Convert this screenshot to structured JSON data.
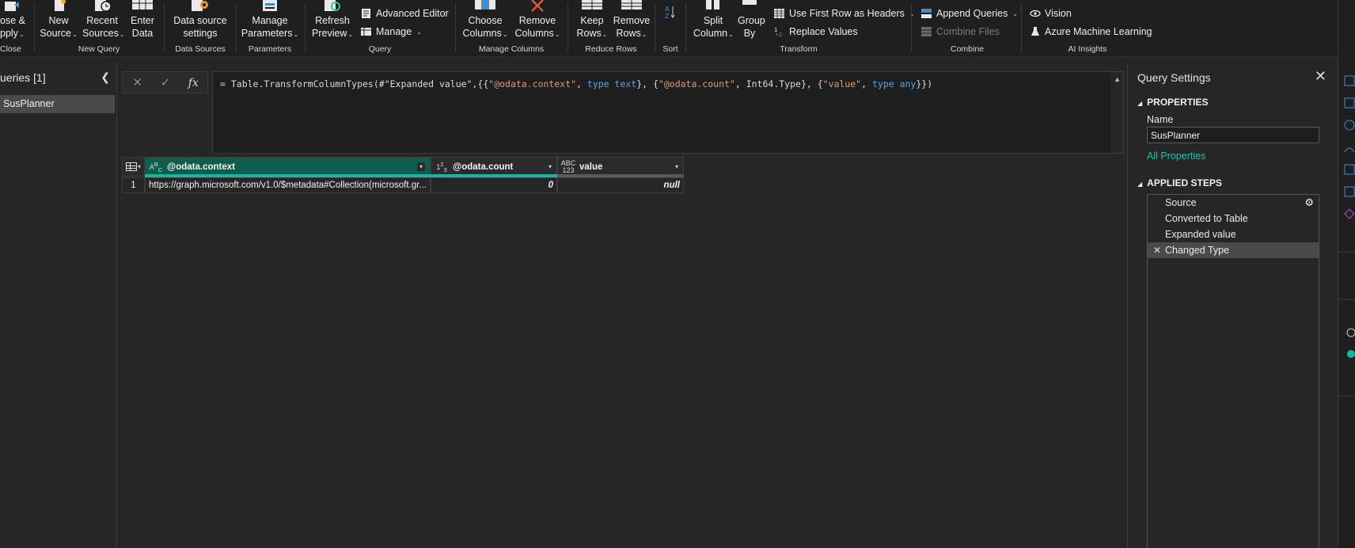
{
  "ribbon": {
    "groups": [
      {
        "label": "Close",
        "buttons": [
          {
            "line1": "ose &",
            "line2": "pply"
          }
        ]
      },
      {
        "label": "New Query",
        "buttons": [
          {
            "line1": "New",
            "line2": "Source"
          },
          {
            "line1": "Recent",
            "line2": "Sources"
          },
          {
            "line1": "Enter",
            "line2": "Data"
          }
        ]
      },
      {
        "label": "Data Sources",
        "buttons": [
          {
            "line1": "Data source",
            "line2": "settings"
          }
        ]
      },
      {
        "label": "Parameters",
        "buttons": [
          {
            "line1": "Manage",
            "line2": "Parameters"
          }
        ]
      },
      {
        "label": "Query",
        "buttons": [
          {
            "line1": "Refresh",
            "line2": "Preview"
          }
        ],
        "small": [
          {
            "label": "Advanced Editor",
            "icon": "advanced-editor-icon"
          },
          {
            "label": "Manage",
            "icon": "manage-icon"
          }
        ]
      },
      {
        "label": "Manage Columns",
        "buttons": [
          {
            "line1": "Choose",
            "line2": "Columns"
          },
          {
            "line1": "Remove",
            "line2": "Columns"
          }
        ]
      },
      {
        "label": "Reduce Rows",
        "buttons": [
          {
            "line1": "Keep",
            "line2": "Rows"
          },
          {
            "line1": "Remove",
            "line2": "Rows"
          }
        ]
      },
      {
        "label": "Sort",
        "buttons": [
          {
            "line1": "",
            "line2": ""
          }
        ]
      },
      {
        "label": "Transform",
        "buttons": [
          {
            "line1": "Split",
            "line2": "Column"
          },
          {
            "line1": "Group",
            "line2": "By"
          }
        ],
        "small": [
          {
            "label": "Use First Row as Headers",
            "icon": "first-row-headers-icon"
          },
          {
            "label": "Replace Values",
            "icon": "replace-values-icon"
          }
        ]
      },
      {
        "label": "Combine",
        "small": [
          {
            "label": "Append Queries",
            "icon": "append-queries-icon"
          },
          {
            "label": "Combine Files",
            "icon": "combine-files-icon"
          }
        ]
      },
      {
        "label": "AI Insights",
        "small": [
          {
            "label": "Vision",
            "icon": "vision-icon"
          },
          {
            "label": "Azure Machine Learning",
            "icon": "azure-ml-icon"
          }
        ]
      }
    ]
  },
  "queries_pane": {
    "title": "ueries [1]",
    "items": [
      {
        "label": "SusPlanner"
      }
    ]
  },
  "formula_bar": {
    "fx_label": "fx",
    "segments": [
      {
        "t": "= Table.TransformColumnTypes(#\"Expanded value\",{{",
        "c": ""
      },
      {
        "t": "\"@odata.context\"",
        "c": "s"
      },
      {
        "t": ", ",
        "c": ""
      },
      {
        "t": "type text",
        "c": "k"
      },
      {
        "t": "}, {",
        "c": ""
      },
      {
        "t": "\"@odata.count\"",
        "c": "s"
      },
      {
        "t": ", Int64.Type}, {",
        "c": ""
      },
      {
        "t": "\"value\"",
        "c": "s"
      },
      {
        "t": ", ",
        "c": ""
      },
      {
        "t": "type any",
        "c": "k"
      },
      {
        "t": "}})",
        "c": ""
      }
    ]
  },
  "grid": {
    "columns": [
      {
        "name": "@odata.context",
        "type_icon": "ABC"
      },
      {
        "name": "@odata.count",
        "type_icon": "123"
      },
      {
        "name": "value",
        "type_icon": "ABC123"
      }
    ],
    "rows": [
      {
        "index": "1",
        "cells": [
          "https://graph.microsoft.com/v1.0/$metadata#Collection(microsoft.gr...",
          "0",
          "null"
        ]
      }
    ]
  },
  "query_settings": {
    "title": "Query Settings",
    "properties_heading": "PROPERTIES",
    "name_label": "Name",
    "name_value": "SusPlanner",
    "all_properties_link": "All Properties",
    "applied_steps_heading": "APPLIED STEPS",
    "steps": [
      {
        "label": "Source"
      },
      {
        "label": "Converted to Table"
      },
      {
        "label": "Expanded value"
      },
      {
        "label": "Changed Type"
      }
    ]
  },
  "colors": {
    "accent": "#19b3a0",
    "selected_header": "#0f5d4f",
    "link": "#27c2a5"
  }
}
